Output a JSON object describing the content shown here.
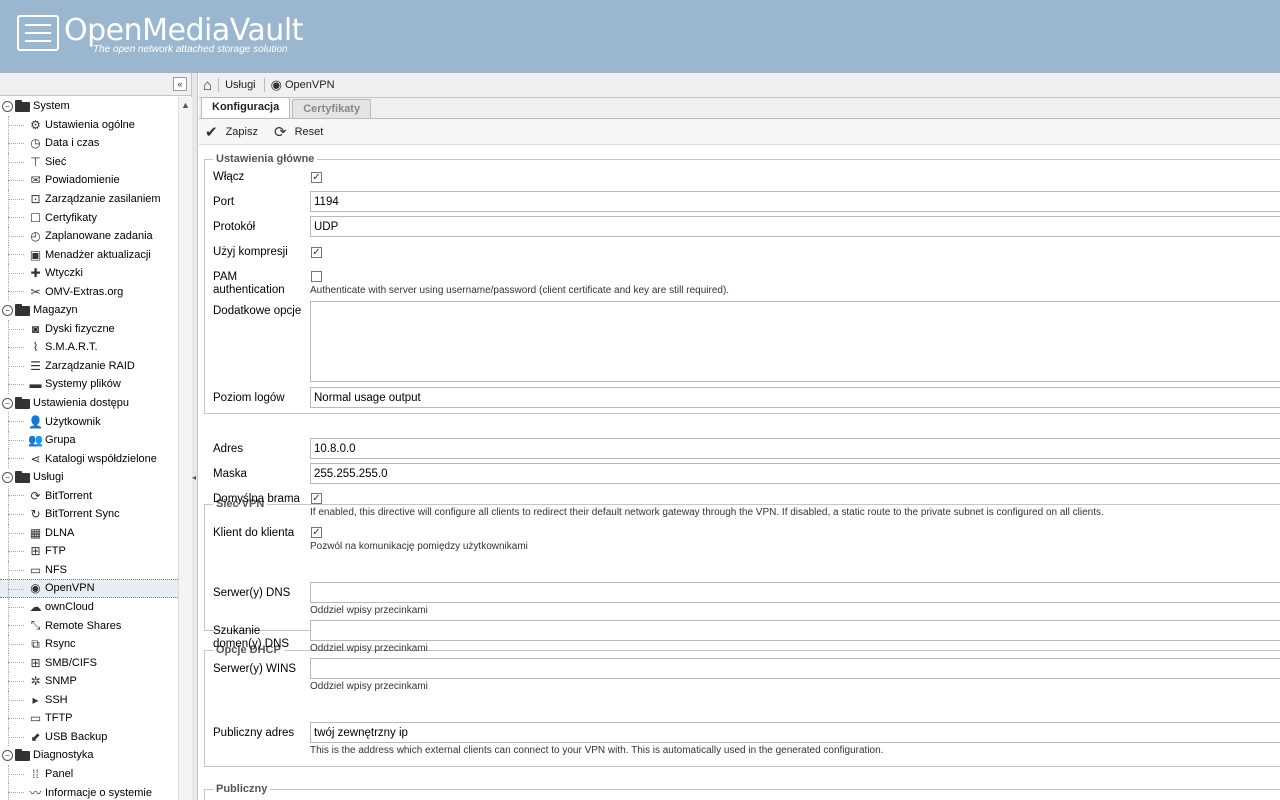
{
  "header": {
    "title": "OpenMediaVault",
    "subtitle": "The open network attached storage solution"
  },
  "sidebar": {
    "collapse_icon": "«",
    "tree": [
      {
        "type": "group",
        "label": "System",
        "icon": "folder-open-icon"
      },
      {
        "type": "child",
        "label": "Ustawienia ogólne",
        "icon": "cogs-icon",
        "glyph": "⚙"
      },
      {
        "type": "child",
        "label": "Data i czas",
        "icon": "clock-icon",
        "glyph": "◷"
      },
      {
        "type": "child",
        "label": "Sieć",
        "icon": "network-icon",
        "glyph": "⊤"
      },
      {
        "type": "child",
        "label": "Powiadomienie",
        "icon": "envelope-icon",
        "glyph": "✉"
      },
      {
        "type": "child",
        "label": "Zarządzanie zasilaniem",
        "icon": "power-icon",
        "glyph": "⊡"
      },
      {
        "type": "child",
        "label": "Certyfikaty",
        "icon": "certificate-icon",
        "glyph": "☐"
      },
      {
        "type": "child",
        "label": "Zaplanowane zadania",
        "icon": "alarm-icon",
        "glyph": "◴"
      },
      {
        "type": "child",
        "label": "Menadżer aktualizacji",
        "icon": "update-icon",
        "glyph": "▣"
      },
      {
        "type": "child",
        "label": "Wtyczki",
        "icon": "puzzle-icon",
        "glyph": "✚"
      },
      {
        "type": "child",
        "label": "OMV-Extras.org",
        "icon": "tools-icon",
        "glyph": "✂"
      },
      {
        "type": "group",
        "label": "Magazyn",
        "icon": "folder-open-icon"
      },
      {
        "type": "child",
        "label": "Dyski fizyczne",
        "icon": "disk-icon",
        "glyph": "◙"
      },
      {
        "type": "child",
        "label": "S.M.A.R.T.",
        "icon": "pulse-icon",
        "glyph": "⌇"
      },
      {
        "type": "child",
        "label": "Zarządzanie RAID",
        "icon": "database-icon",
        "glyph": "☰"
      },
      {
        "type": "child",
        "label": "Systemy plików",
        "icon": "folder-icon",
        "glyph": "▬"
      },
      {
        "type": "group",
        "label": "Ustawienia dostępu",
        "icon": "folder-open-icon"
      },
      {
        "type": "child",
        "label": "Użytkownik",
        "icon": "user-icon",
        "glyph": "👤"
      },
      {
        "type": "child",
        "label": "Grupa",
        "icon": "group-icon",
        "glyph": "👥"
      },
      {
        "type": "child",
        "label": "Katalogi współdzielone",
        "icon": "share-icon",
        "glyph": "⋖"
      },
      {
        "type": "group",
        "label": "Usługi",
        "icon": "folder-open-icon"
      },
      {
        "type": "child",
        "label": "BitTorrent",
        "icon": "bittorrent-icon",
        "glyph": "⟳"
      },
      {
        "type": "child",
        "label": "BitTorrent Sync",
        "icon": "sync-icon",
        "glyph": "↻"
      },
      {
        "type": "child",
        "label": "DLNA",
        "icon": "film-icon",
        "glyph": "▦"
      },
      {
        "type": "child",
        "label": "FTP",
        "icon": "ftp-icon",
        "glyph": "⊞"
      },
      {
        "type": "child",
        "label": "NFS",
        "icon": "nfs-icon",
        "glyph": "▭"
      },
      {
        "type": "child",
        "label": "OpenVPN",
        "icon": "openvpn-icon",
        "glyph": "◉",
        "selected": true
      },
      {
        "type": "child",
        "label": "ownCloud",
        "icon": "cloud-icon",
        "glyph": "☁"
      },
      {
        "type": "child",
        "label": "Remote Shares",
        "icon": "remote-icon",
        "glyph": "⤡"
      },
      {
        "type": "child",
        "label": "Rsync",
        "icon": "rsync-icon",
        "glyph": "⧉"
      },
      {
        "type": "child",
        "label": "SMB/CIFS",
        "icon": "windows-icon",
        "glyph": "⊞"
      },
      {
        "type": "child",
        "label": "SNMP",
        "icon": "snmp-icon",
        "glyph": "✲"
      },
      {
        "type": "child",
        "label": "SSH",
        "icon": "terminal-icon",
        "glyph": "▸"
      },
      {
        "type": "child",
        "label": "TFTP",
        "icon": "monitor-icon",
        "glyph": "▭"
      },
      {
        "type": "child",
        "label": "USB Backup",
        "icon": "usb-icon",
        "glyph": "⬋"
      },
      {
        "type": "group",
        "label": "Diagnostyka",
        "icon": "folder-open-icon"
      },
      {
        "type": "child",
        "label": "Panel",
        "icon": "dashboard-icon",
        "glyph": "⁞⁞"
      },
      {
        "type": "child",
        "label": "Informacje o systemie",
        "icon": "chart-icon",
        "glyph": "〰"
      }
    ]
  },
  "breadcrumb": {
    "service": "Usługi",
    "page": "OpenVPN"
  },
  "tabs": [
    {
      "label": "Konfiguracja",
      "active": true
    },
    {
      "label": "Certyfikaty",
      "active": false
    }
  ],
  "toolbar": {
    "save_label": "Zapisz",
    "reset_label": "Reset"
  },
  "sections": {
    "main": {
      "legend": "Ustawienia główne",
      "enable_label": "Włącz",
      "enable_checked": true,
      "port_label": "Port",
      "port_value": "1194",
      "protocol_label": "Protokół",
      "protocol_value": "UDP",
      "compression_label": "Użyj kompresji",
      "compression_checked": true,
      "pam_label_line1": "PAM",
      "pam_label_line2": "authentication",
      "pam_checked": false,
      "pam_hint": "Authenticate with server using username/password (client certificate and key are still required).",
      "extra_label": "Dodatkowe opcje",
      "extra_value": "",
      "loglevel_label": "Poziom logów",
      "loglevel_value": "Normal usage output"
    },
    "vpn": {
      "legend": "Sieć VPN",
      "address_label": "Adres",
      "address_value": "10.8.0.0",
      "mask_label": "Maska",
      "mask_value": "255.255.255.0",
      "gateway_label": "Domyślna brama",
      "gateway_checked": true,
      "gateway_hint": "If enabled, this directive will configure all clients to redirect their default network gateway through the VPN. If disabled, a static route to the private subnet is configured on all clients.",
      "c2c_label": "Klient do klienta",
      "c2c_checked": true,
      "c2c_hint": "Pozwól na komunikację pomiędzy użytkownikami"
    },
    "dhcp": {
      "legend": "Opcje DHCP",
      "dns_label": "Serwer(y) DNS",
      "dns_value": "",
      "dns_hint": "Oddziel wpisy przecinkami",
      "domain_label_line1": "Szukanie",
      "domain_label_line2": "domen(y) DNS",
      "domain_value": "",
      "domain_hint": "Oddziel wpisy przecinkami",
      "wins_label": "Serwer(y) WINS",
      "wins_value": "",
      "wins_hint": "Oddziel wpisy przecinkami"
    },
    "public": {
      "legend": "Publiczny",
      "address_label": "Publiczny adres",
      "address_value": "twój zewnętrzny ip",
      "address_hint": "This is the address which external clients can connect to your VPN with. This is automatically used in the generated configuration."
    }
  }
}
